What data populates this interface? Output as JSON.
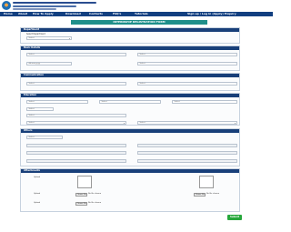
{
  "nav": {
    "items": [
      "Home",
      "About",
      "How To Apply",
      "Download",
      "Contacts",
      "FAQ's",
      "Tutorials",
      "Sign up / Log in (Apply) Enquiry"
    ]
  },
  "page": {
    "title": "INTERNSHIP REGISTRATION FORM"
  },
  "sections": [
    {
      "title": "Department"
    },
    {
      "title": "Basic Details"
    },
    {
      "title": "Communication"
    },
    {
      "title": "Education"
    },
    {
      "title": "Others"
    },
    {
      "title": "Attachments"
    }
  ],
  "form": {
    "dept_label": "Select Department",
    "placeholder": "Select",
    "date_placeholder": "dd-mm-yyyy",
    "gender_value": "Select",
    "category_value": "Select"
  },
  "attachments": {
    "upload_label": "Upload",
    "choose_label": "Choose File",
    "no_file_label": "No file chosen"
  },
  "actions": {
    "submit_label": "Submit"
  },
  "colors": {
    "nav": "#123f80",
    "panel_header": "#183f79",
    "title_bar": "#1f8f8a",
    "submit": "#27a73c"
  }
}
